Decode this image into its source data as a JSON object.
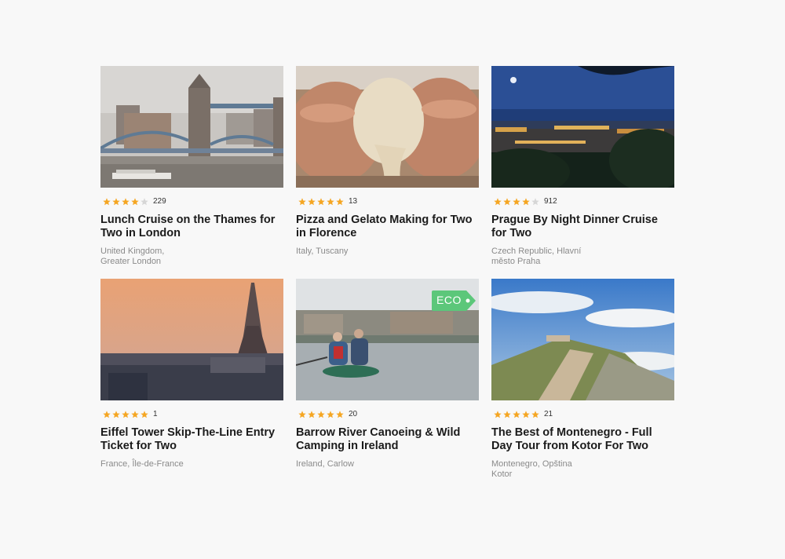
{
  "colors": {
    "background": "#f8f8f8",
    "star_filled": "#f5a623",
    "star_empty": "#d6d6d6",
    "eco_badge": "#5cc77a",
    "title": "#1b1b1b",
    "location": "#8a8a8a"
  },
  "cards": [
    {
      "image": "tower-bridge-london",
      "rating_stars": 4,
      "reviews": "229",
      "title": "Lunch Cruise on the Thames for Two in London",
      "location_line1": "United Kingdom,",
      "location_line2": "Greater London",
      "badge": ""
    },
    {
      "image": "pizza-dough-hands",
      "rating_stars": 5,
      "reviews": "13",
      "title": "Pizza and Gelato Making for Two in Florence",
      "location_line1": "Italy, Tuscany",
      "location_line2": "",
      "badge": ""
    },
    {
      "image": "prague-night-city",
      "rating_stars": 4,
      "reviews": "912",
      "title": "Prague By Night Dinner Cruise for Two",
      "location_line1": "Czech Republic, Hlavní",
      "location_line2": "město Praha",
      "badge": ""
    },
    {
      "image": "eiffel-tower-sunset",
      "rating_stars": 5,
      "reviews": "1",
      "title": "Eiffel Tower Skip-The-Line Entry Ticket for Two",
      "location_line1": "France, Île-de-France",
      "location_line2": "",
      "badge": ""
    },
    {
      "image": "canoe-river-ireland",
      "rating_stars": 5,
      "reviews": "20",
      "title": "Barrow River Canoeing & Wild Camping in Ireland",
      "location_line1": "Ireland, Carlow",
      "location_line2": "",
      "badge": "ECO"
    },
    {
      "image": "montenegro-mountain-road",
      "rating_stars": 5,
      "reviews": "21",
      "title": "The Best of Montenegro - Full Day Tour from Kotor For Two",
      "location_line1": "Montenegro, Opština",
      "location_line2": "Kotor",
      "badge": ""
    }
  ]
}
